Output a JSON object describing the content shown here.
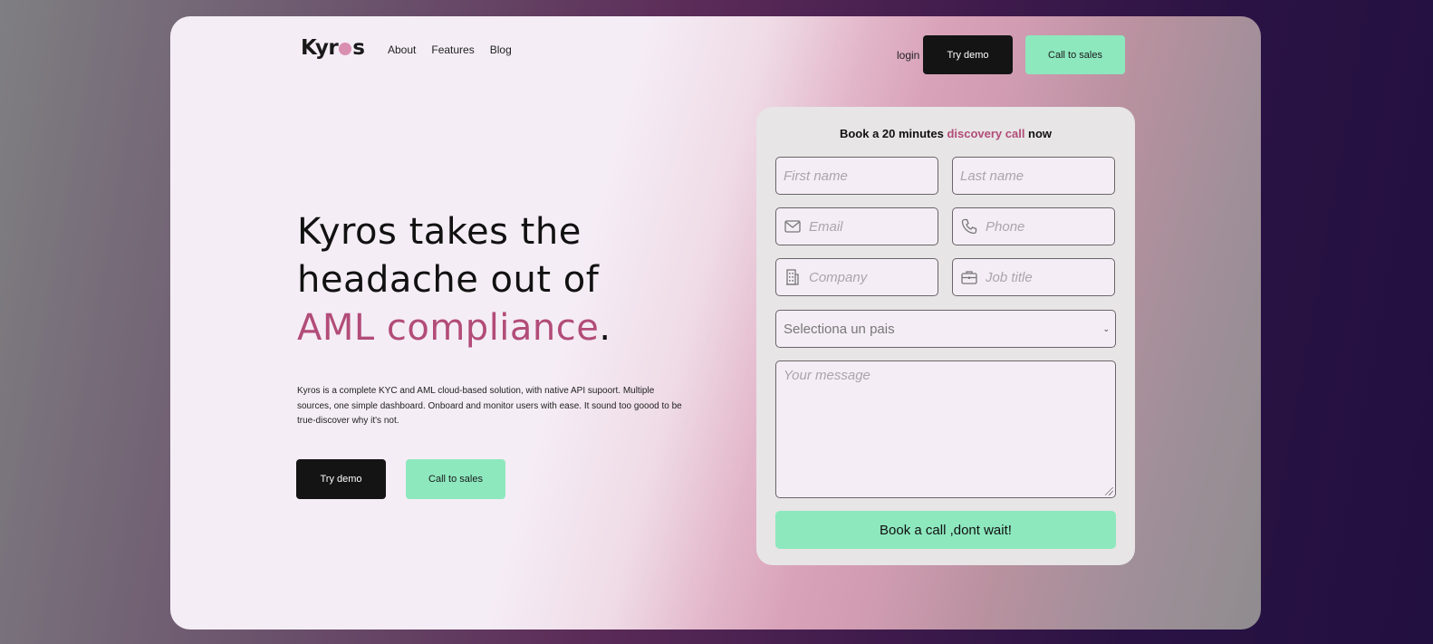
{
  "nav": {
    "logo_prefix": "Kyr",
    "logo_suffix": "s",
    "links": [
      "About",
      "Features",
      "Blog"
    ],
    "login": "login",
    "try_demo": "Try demo",
    "call_sales": "Call to sales"
  },
  "hero": {
    "line1": "Kyros takes the",
    "line2": "headache out of",
    "accent": "AML compliance",
    "period": ".",
    "description": "Kyros is a complete KYC and AML cloud-based solution, with native API supoort. Multiple sources, one simple dashboard. Onboard and monitor users with ease. It sound too goood to be true-discover why it's not.",
    "try_demo": "Try demo",
    "call_sales": "Call to sales"
  },
  "form": {
    "title_prefix": "Book a 20 minutes ",
    "title_accent": "discovery call",
    "title_suffix": " now",
    "first_name": "First name",
    "last_name": "Last name",
    "email": "Email",
    "phone": "Phone",
    "company": "Company",
    "job_title": "Job title",
    "country_select": "Selectiona un pais",
    "message": "Your message",
    "submit": "Book a call ,dont wait!"
  },
  "colors": {
    "accent": "#b24c78",
    "mint": "#8de8be",
    "dark_button": "#141414"
  },
  "icons": [
    "mail-icon",
    "phone-icon",
    "building-icon",
    "briefcase-icon",
    "chevron-down-icon"
  ]
}
